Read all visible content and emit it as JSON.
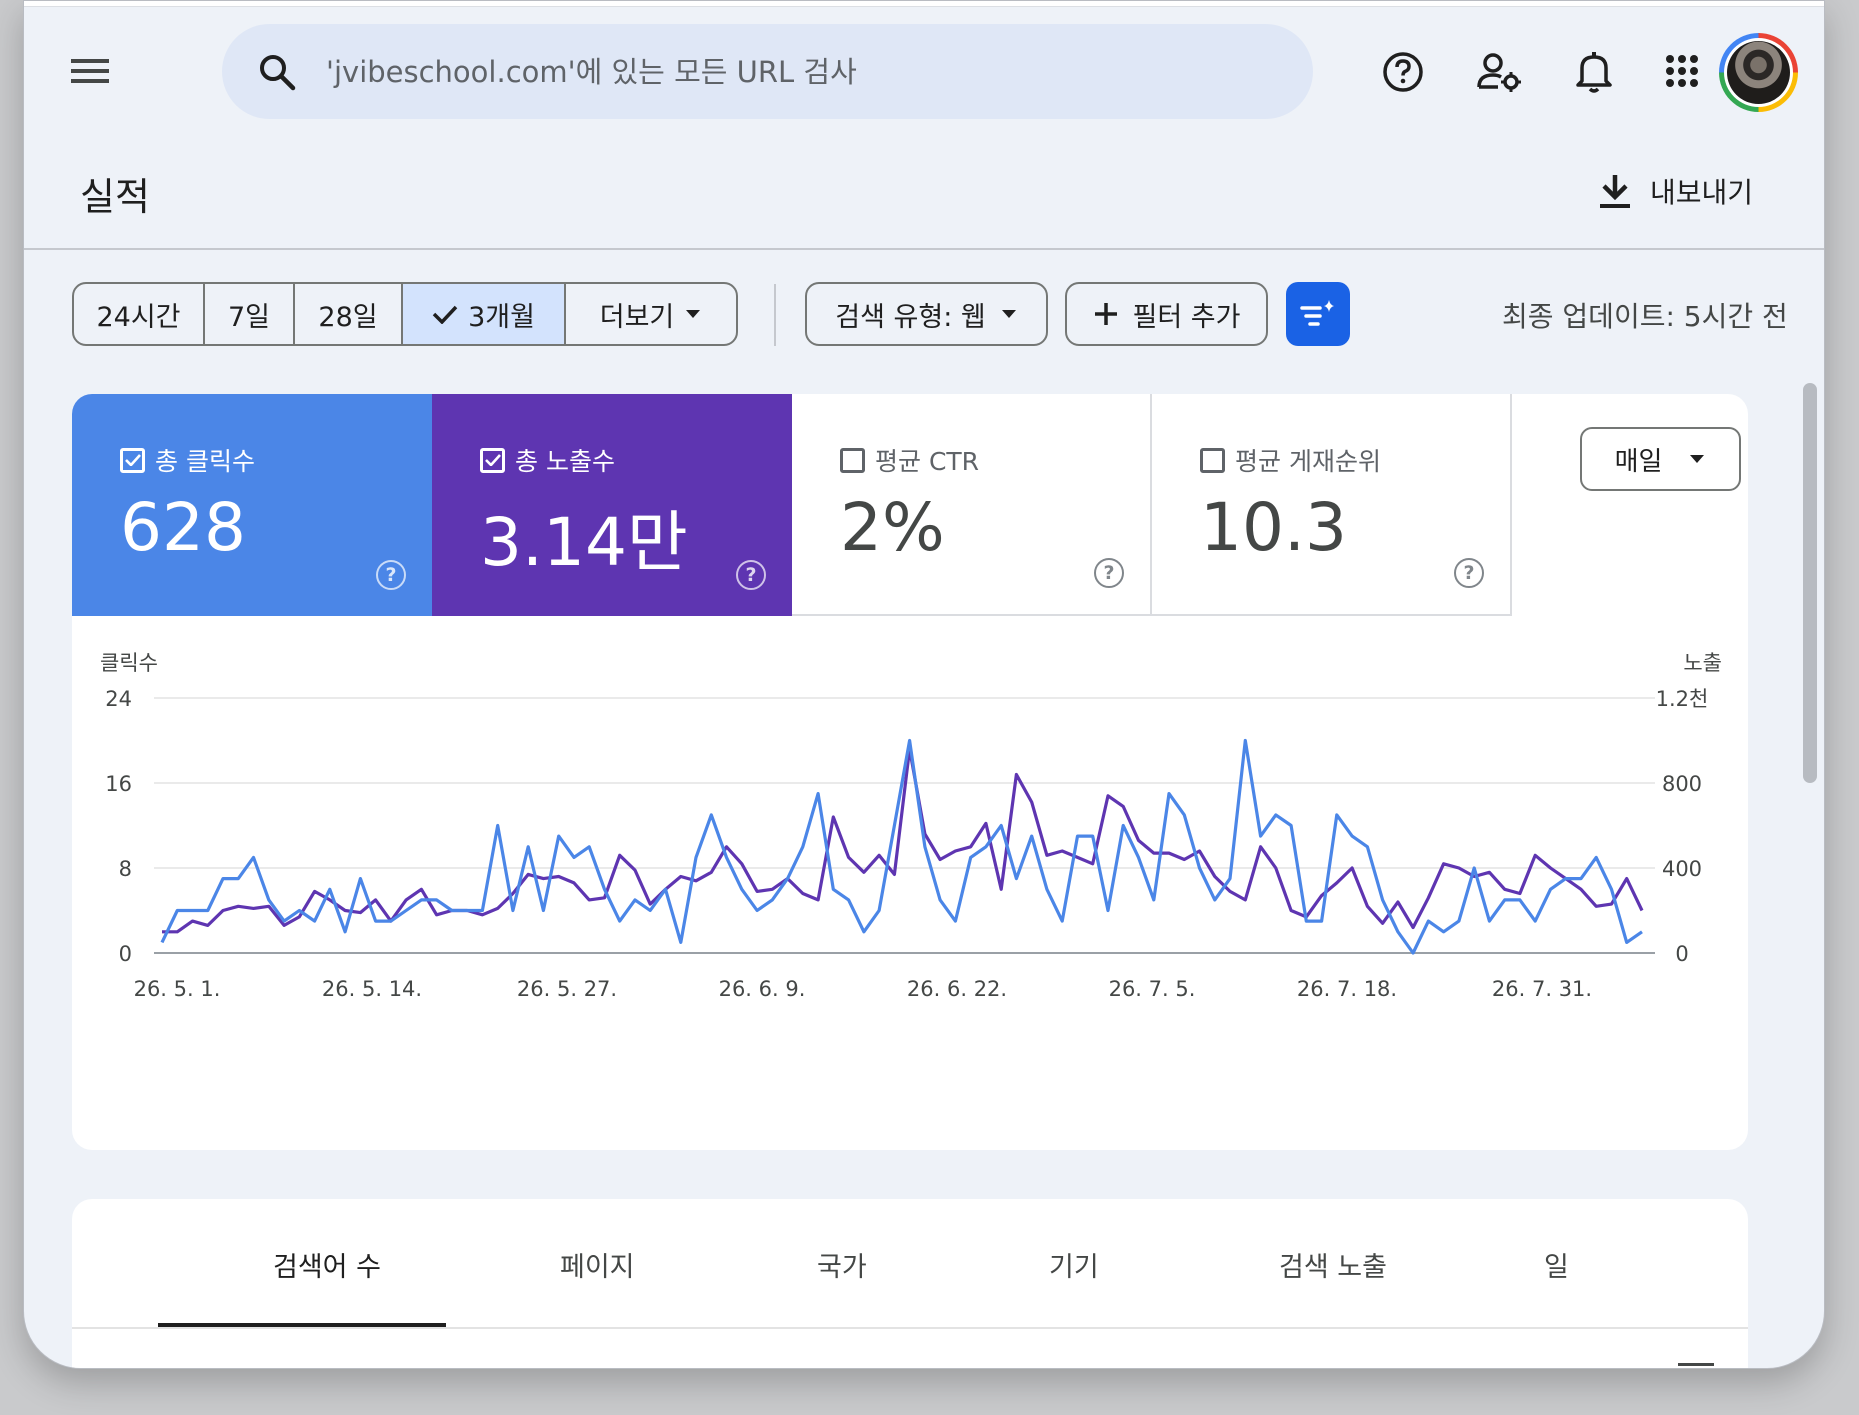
{
  "search": {
    "placeholder": "'jvibeschool.com'에 있는 모든 URL 검사"
  },
  "header": {
    "icons": [
      "menu-icon",
      "search-icon",
      "help-icon",
      "manage-users-icon",
      "notifications-icon",
      "apps-icon",
      "avatar"
    ]
  },
  "page": {
    "title": "실적",
    "export_label": "내보내기"
  },
  "filters": {
    "ranges": [
      "24시간",
      "7일",
      "28일",
      "3개월",
      "더보기"
    ],
    "active_range": "3개월",
    "search_type": "검색 유형: 웹",
    "add_filter": "필터 추가",
    "last_update": "최종 업데이트: 5시간 전"
  },
  "metrics": [
    {
      "label": "총 클릭수",
      "value": "628",
      "checked": true,
      "color": "#4b86e7"
    },
    {
      "label": "총 노출수",
      "value": "3.14만",
      "checked": true,
      "color": "#5e35b1"
    },
    {
      "label": "평균 CTR",
      "value": "2%",
      "checked": false
    },
    {
      "label": "평균 게재순위",
      "value": "10.3",
      "checked": false
    }
  ],
  "granularity": "매일",
  "chart_data": {
    "type": "line",
    "left_axis_label": "클릭수",
    "right_axis_label": "노출",
    "left_ticks": [
      "24",
      "16",
      "8",
      "0"
    ],
    "right_ticks": [
      "1.2천",
      "800",
      "400",
      "0"
    ],
    "left_ylim": [
      0,
      24
    ],
    "right_ylim": [
      0,
      1200
    ],
    "x_ticks": [
      "26. 5. 1.",
      "26. 5. 14.",
      "26. 5. 27.",
      "26. 6. 9.",
      "26. 6. 22.",
      "26. 7. 5.",
      "26. 7. 18.",
      "26. 7. 31."
    ],
    "grid": true,
    "series": [
      {
        "name": "클릭수",
        "axis": "left",
        "color": "#4b86e7",
        "values": [
          1,
          4,
          4,
          4,
          7,
          7,
          9,
          5,
          3,
          4,
          3,
          6,
          2,
          7,
          3,
          3,
          4,
          5,
          5,
          4,
          4,
          4,
          12,
          4,
          10,
          4,
          11,
          9,
          10,
          6,
          3,
          5,
          4,
          6,
          1,
          9,
          13,
          9,
          6,
          4,
          5,
          7,
          10,
          15,
          6,
          5,
          2,
          4,
          12,
          20,
          10,
          5,
          3,
          9,
          10,
          12,
          7,
          11,
          6,
          3,
          11,
          11,
          4,
          12,
          9,
          5,
          15,
          13,
          8,
          5,
          7,
          20,
          11,
          13,
          12,
          3,
          3,
          13,
          11,
          10,
          5,
          2,
          0,
          3,
          2,
          3,
          8,
          3,
          5,
          5,
          3,
          6,
          7,
          7,
          9,
          6,
          1,
          2
        ]
      },
      {
        "name": "노출",
        "axis": "right",
        "color": "#5e35b1",
        "values": [
          100,
          100,
          150,
          130,
          200,
          220,
          210,
          220,
          130,
          170,
          290,
          250,
          200,
          190,
          250,
          150,
          250,
          300,
          180,
          200,
          200,
          180,
          210,
          280,
          370,
          350,
          360,
          330,
          250,
          260,
          460,
          390,
          230,
          300,
          360,
          340,
          380,
          500,
          420,
          290,
          300,
          350,
          280,
          250,
          640,
          450,
          380,
          460,
          370,
          960,
          560,
          440,
          480,
          500,
          610,
          300,
          840,
          710,
          460,
          480,
          450,
          420,
          740,
          690,
          530,
          470,
          470,
          440,
          480,
          360,
          290,
          250,
          500,
          400,
          200,
          170,
          270,
          330,
          400,
          220,
          140,
          240,
          120,
          260,
          420,
          400,
          360,
          380,
          300,
          280,
          460,
          400,
          350,
          300,
          220,
          230,
          350,
          200
        ]
      }
    ]
  },
  "tabs": {
    "items": [
      "검색어 수",
      "페이지",
      "국가",
      "기기",
      "검색 노출",
      "일"
    ],
    "active": "검색어 수"
  }
}
